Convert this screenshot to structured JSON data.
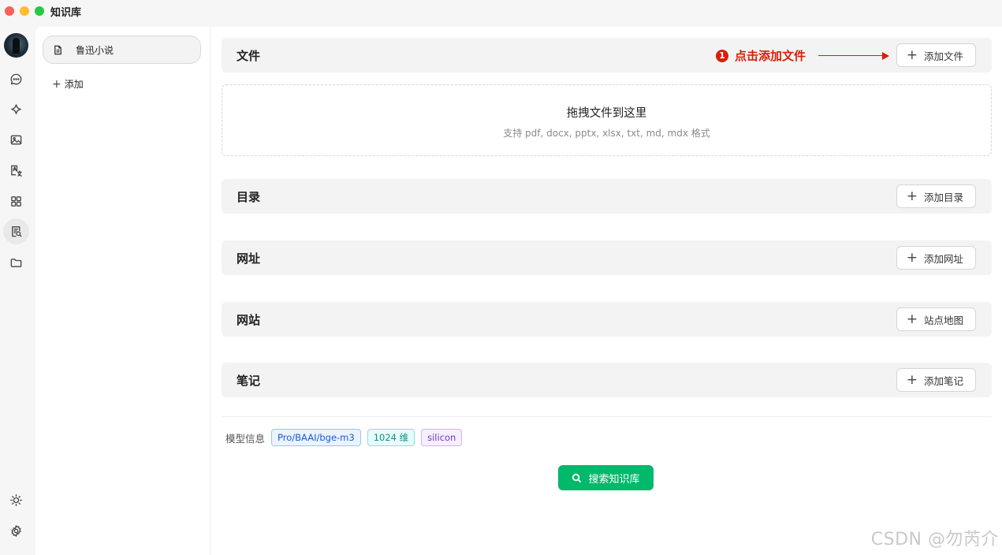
{
  "window": {
    "title": "知识库"
  },
  "rail": {
    "icons": [
      "avatar",
      "chat-icon",
      "sparkle-icon",
      "image-icon",
      "translate-icon",
      "apps-icon",
      "knowledge-icon",
      "folder-icon",
      "theme-icon",
      "settings-icon"
    ],
    "active": "knowledge-icon"
  },
  "kb_list": {
    "items": [
      {
        "label": "鲁迅小说"
      }
    ],
    "add_label": "添加"
  },
  "sections": {
    "files": {
      "title": "文件",
      "button": "添加文件"
    },
    "directory": {
      "title": "目录",
      "button": "添加目录"
    },
    "url": {
      "title": "网址",
      "button": "添加网址"
    },
    "website": {
      "title": "网站",
      "button": "站点地图"
    },
    "notes": {
      "title": "笔记",
      "button": "添加笔记"
    }
  },
  "annotation": {
    "number": "1",
    "text": "点击添加文件",
    "color": "#d81e06"
  },
  "dropzone": {
    "title": "拖拽文件到这里",
    "subtitle": "支持 pdf, docx, pptx, xlsx, txt, md, mdx 格式"
  },
  "model_info": {
    "label": "模型信息",
    "tags": [
      {
        "text": "Pro/BAAI/bge-m3",
        "color": "blue"
      },
      {
        "text": "1024 维",
        "color": "cyan"
      },
      {
        "text": "silicon",
        "color": "purple"
      }
    ]
  },
  "search_button": {
    "label": "搜索知识库",
    "color": "#00b96b"
  },
  "watermark": "CSDN @勿芮介"
}
